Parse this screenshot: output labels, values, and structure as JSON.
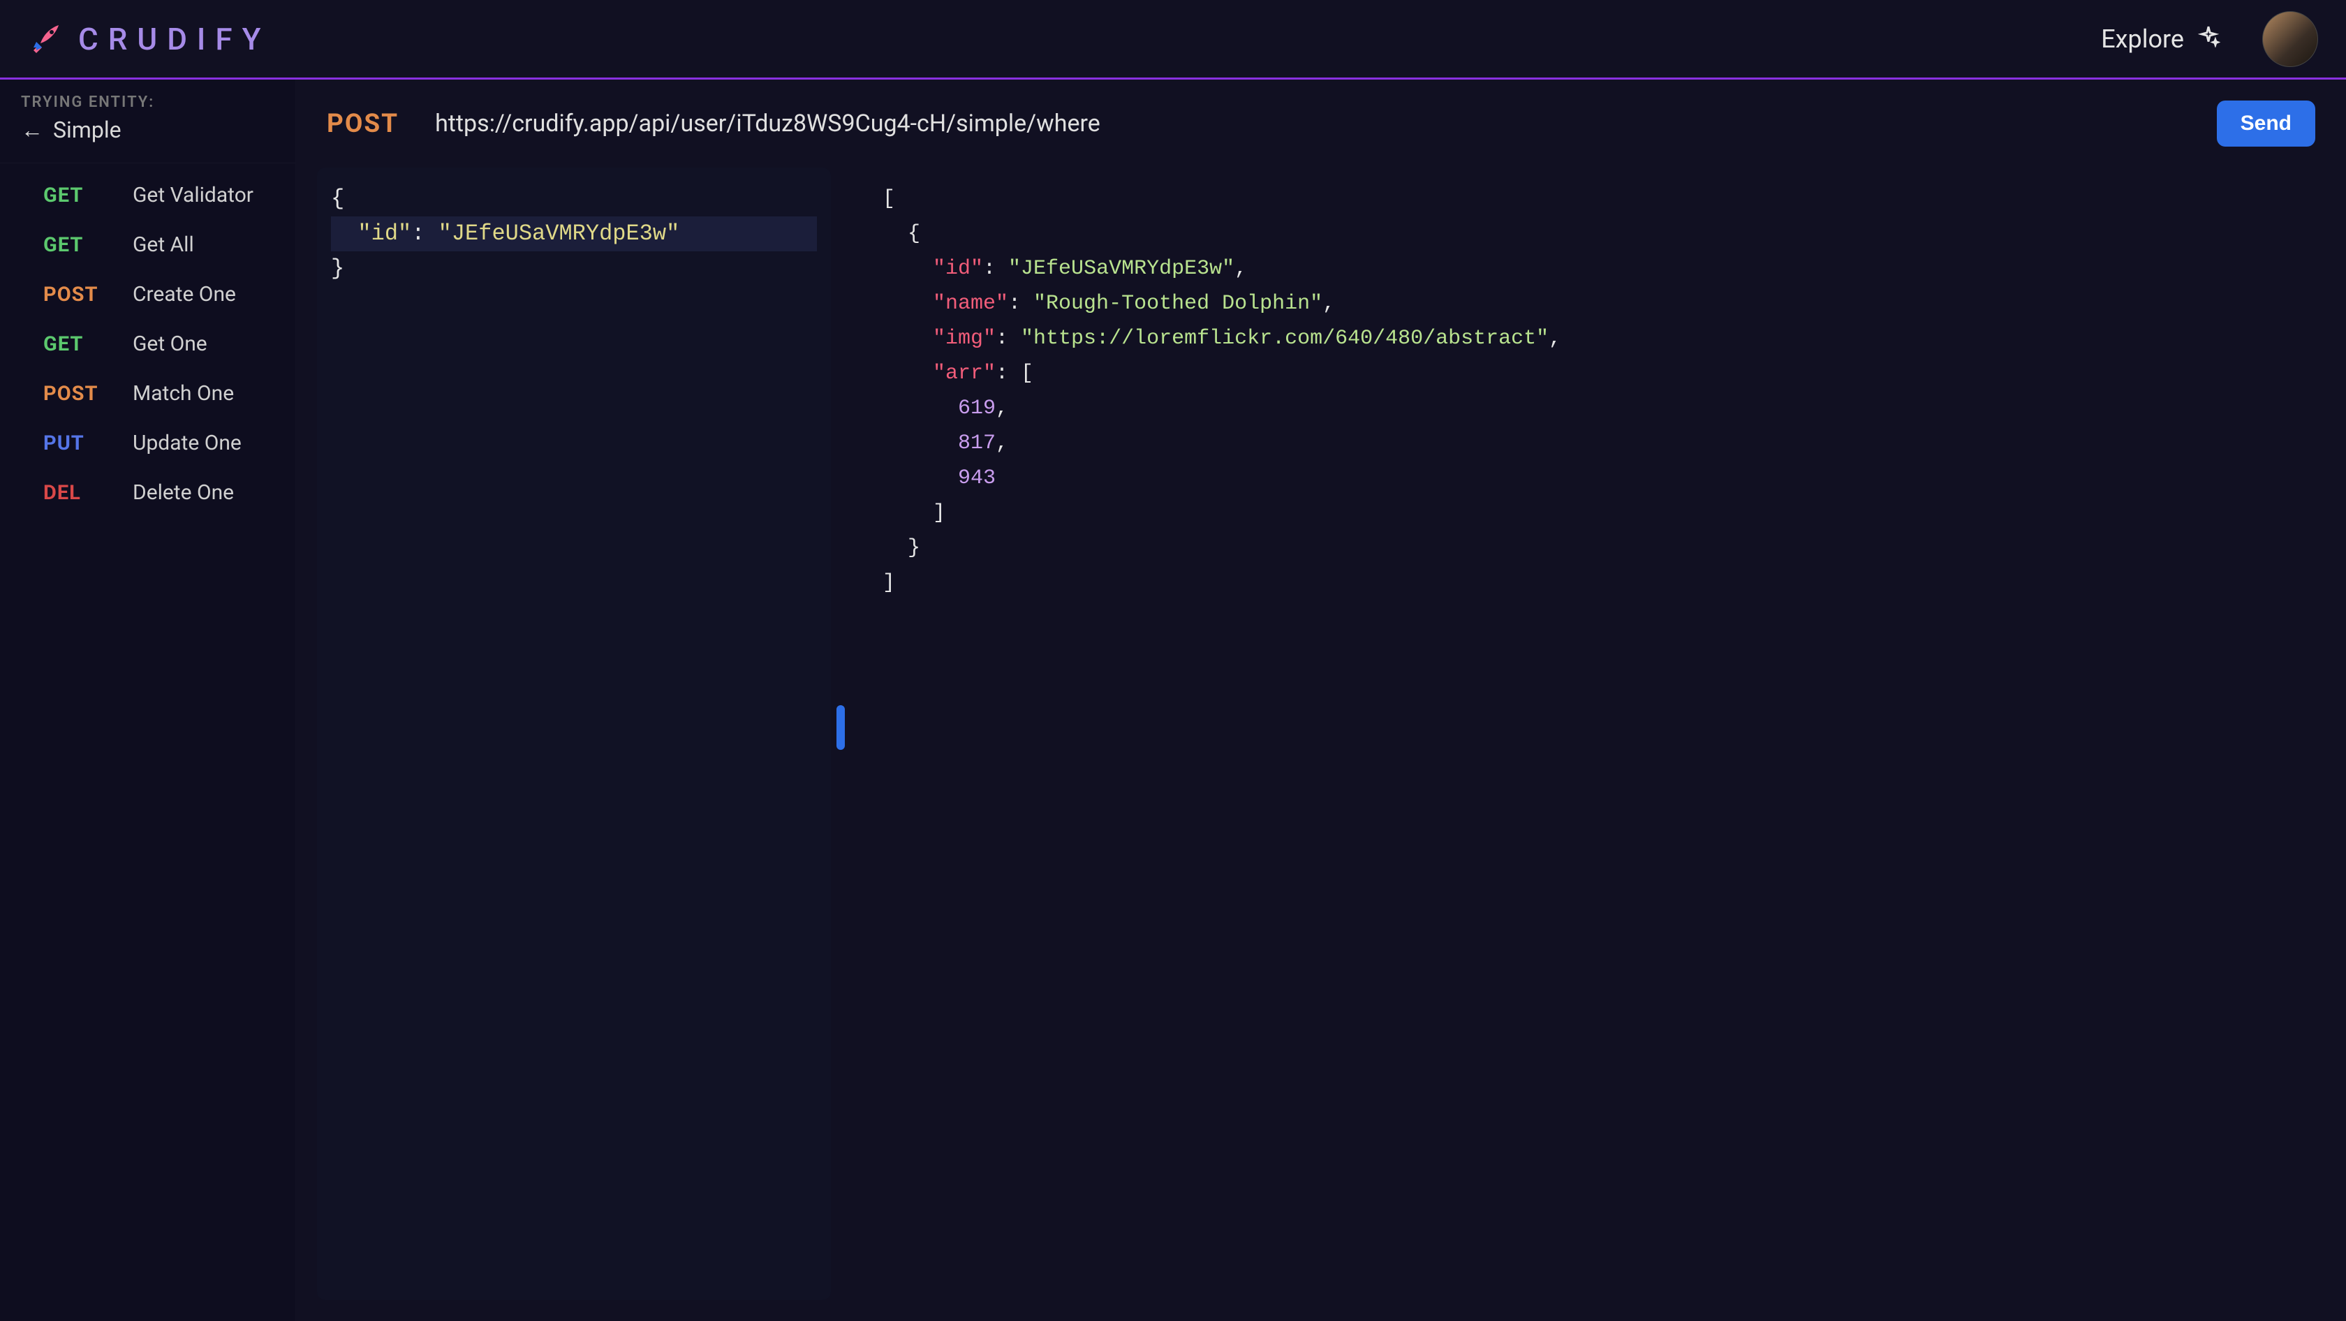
{
  "brand": {
    "name": "CRUDIFY"
  },
  "nav": {
    "explore": "Explore"
  },
  "sidebar": {
    "header_label": "TRYING ENTITY:",
    "entity_name": "Simple",
    "endpoints": [
      {
        "method": "GET",
        "class": "m-get",
        "name": "Get Validator"
      },
      {
        "method": "GET",
        "class": "m-get",
        "name": "Get All"
      },
      {
        "method": "POST",
        "class": "m-post",
        "name": "Create One"
      },
      {
        "method": "GET",
        "class": "m-get",
        "name": "Get One"
      },
      {
        "method": "POST",
        "class": "m-post",
        "name": "Match One"
      },
      {
        "method": "PUT",
        "class": "m-put",
        "name": "Update One"
      },
      {
        "method": "DEL",
        "class": "m-del",
        "name": "Delete One"
      }
    ]
  },
  "request": {
    "method": "POST",
    "url": "https://crudify.app/api/user/iTduz8WS9Cug4-cH/simple/where",
    "send_label": "Send"
  },
  "request_body": {
    "tokens": [
      {
        "t": "{",
        "c": "tk-brace",
        "nl": true,
        "hl": false
      },
      {
        "t": "  \"id\"",
        "c": "tk-key-req",
        "hl": true
      },
      {
        "t": ": ",
        "c": "tk-punct",
        "hl": true
      },
      {
        "t": "\"JEfeUSaVMRYdpE3w\"",
        "c": "tk-str-req",
        "nl": true,
        "hl": true
      },
      {
        "t": "}",
        "c": "tk-brace",
        "hl": false
      }
    ]
  },
  "response_body": {
    "tokens": [
      {
        "t": "[",
        "c": "tk-brace",
        "nl": true
      },
      {
        "t": "  {",
        "c": "tk-brace",
        "nl": true
      },
      {
        "t": "    \"id\"",
        "c": "tk-key"
      },
      {
        "t": ": ",
        "c": "tk-punct"
      },
      {
        "t": "\"JEfeUSaVMRYdpE3w\"",
        "c": "tk-str"
      },
      {
        "t": ",",
        "c": "tk-punct",
        "nl": true
      },
      {
        "t": "    \"name\"",
        "c": "tk-key"
      },
      {
        "t": ": ",
        "c": "tk-punct"
      },
      {
        "t": "\"Rough-Toothed Dolphin\"",
        "c": "tk-str"
      },
      {
        "t": ",",
        "c": "tk-punct",
        "nl": true
      },
      {
        "t": "    \"img\"",
        "c": "tk-key"
      },
      {
        "t": ": ",
        "c": "tk-punct"
      },
      {
        "t": "\"https://loremflickr.com/640/480/abstract\"",
        "c": "tk-str"
      },
      {
        "t": ",",
        "c": "tk-punct",
        "nl": true
      },
      {
        "t": "    \"arr\"",
        "c": "tk-key"
      },
      {
        "t": ": [",
        "c": "tk-punct",
        "nl": true
      },
      {
        "t": "      619",
        "c": "tk-num"
      },
      {
        "t": ",",
        "c": "tk-punct",
        "nl": true
      },
      {
        "t": "      817",
        "c": "tk-num"
      },
      {
        "t": ",",
        "c": "tk-punct",
        "nl": true
      },
      {
        "t": "      943",
        "c": "tk-num",
        "nl": true
      },
      {
        "t": "    ]",
        "c": "tk-punct",
        "nl": true
      },
      {
        "t": "  }",
        "c": "tk-brace",
        "nl": true
      },
      {
        "t": "]",
        "c": "tk-brace"
      }
    ]
  }
}
